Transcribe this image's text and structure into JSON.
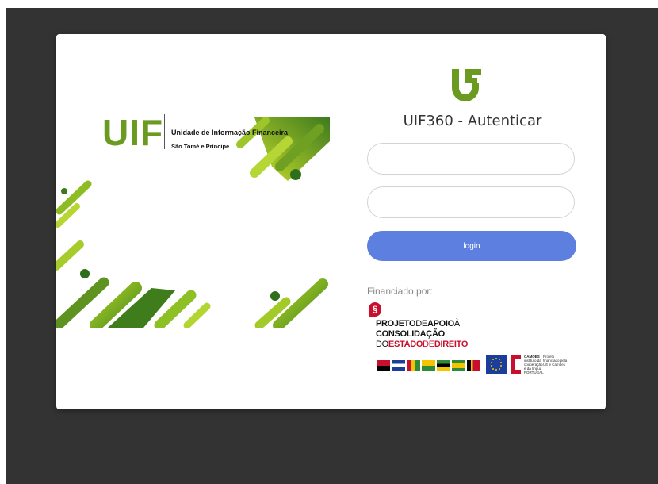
{
  "login": {
    "title": "UIF360 - Autenticar",
    "username_value": "",
    "password_value": "",
    "button_label": "login",
    "funded_by": "Financiado por:"
  },
  "banner": {
    "logo_text": "UIF",
    "org_name": "Unidade de Informação Financeira",
    "org_country": "São Tomé e Príncipe",
    "accent_colors": [
      "#9ccc1c",
      "#6a9a1f",
      "#3e7a1f"
    ]
  },
  "sponsor": {
    "icon": "paragraph-icon",
    "icon_glyph": "§",
    "line1_a": "PROJETO",
    "line1_b": "DE",
    "line1_c": "APOIO",
    "line1_d": "À",
    "line2": "CONSOLIDAÇÃO",
    "line3_a": "DO",
    "line3_b": "ESTADO",
    "line3_c": "DE",
    "line3_d": "DIREITO",
    "camoes_name": "CAMÕES",
    "camoes_sub": "instituto da cooperação e da língua PORTUGAL",
    "camoes_note": "Projeto financiado pela UE e Camões"
  },
  "colors": {
    "background": "#333333",
    "button": "#5c7fe0",
    "brand_green": "#6a9a1f"
  }
}
